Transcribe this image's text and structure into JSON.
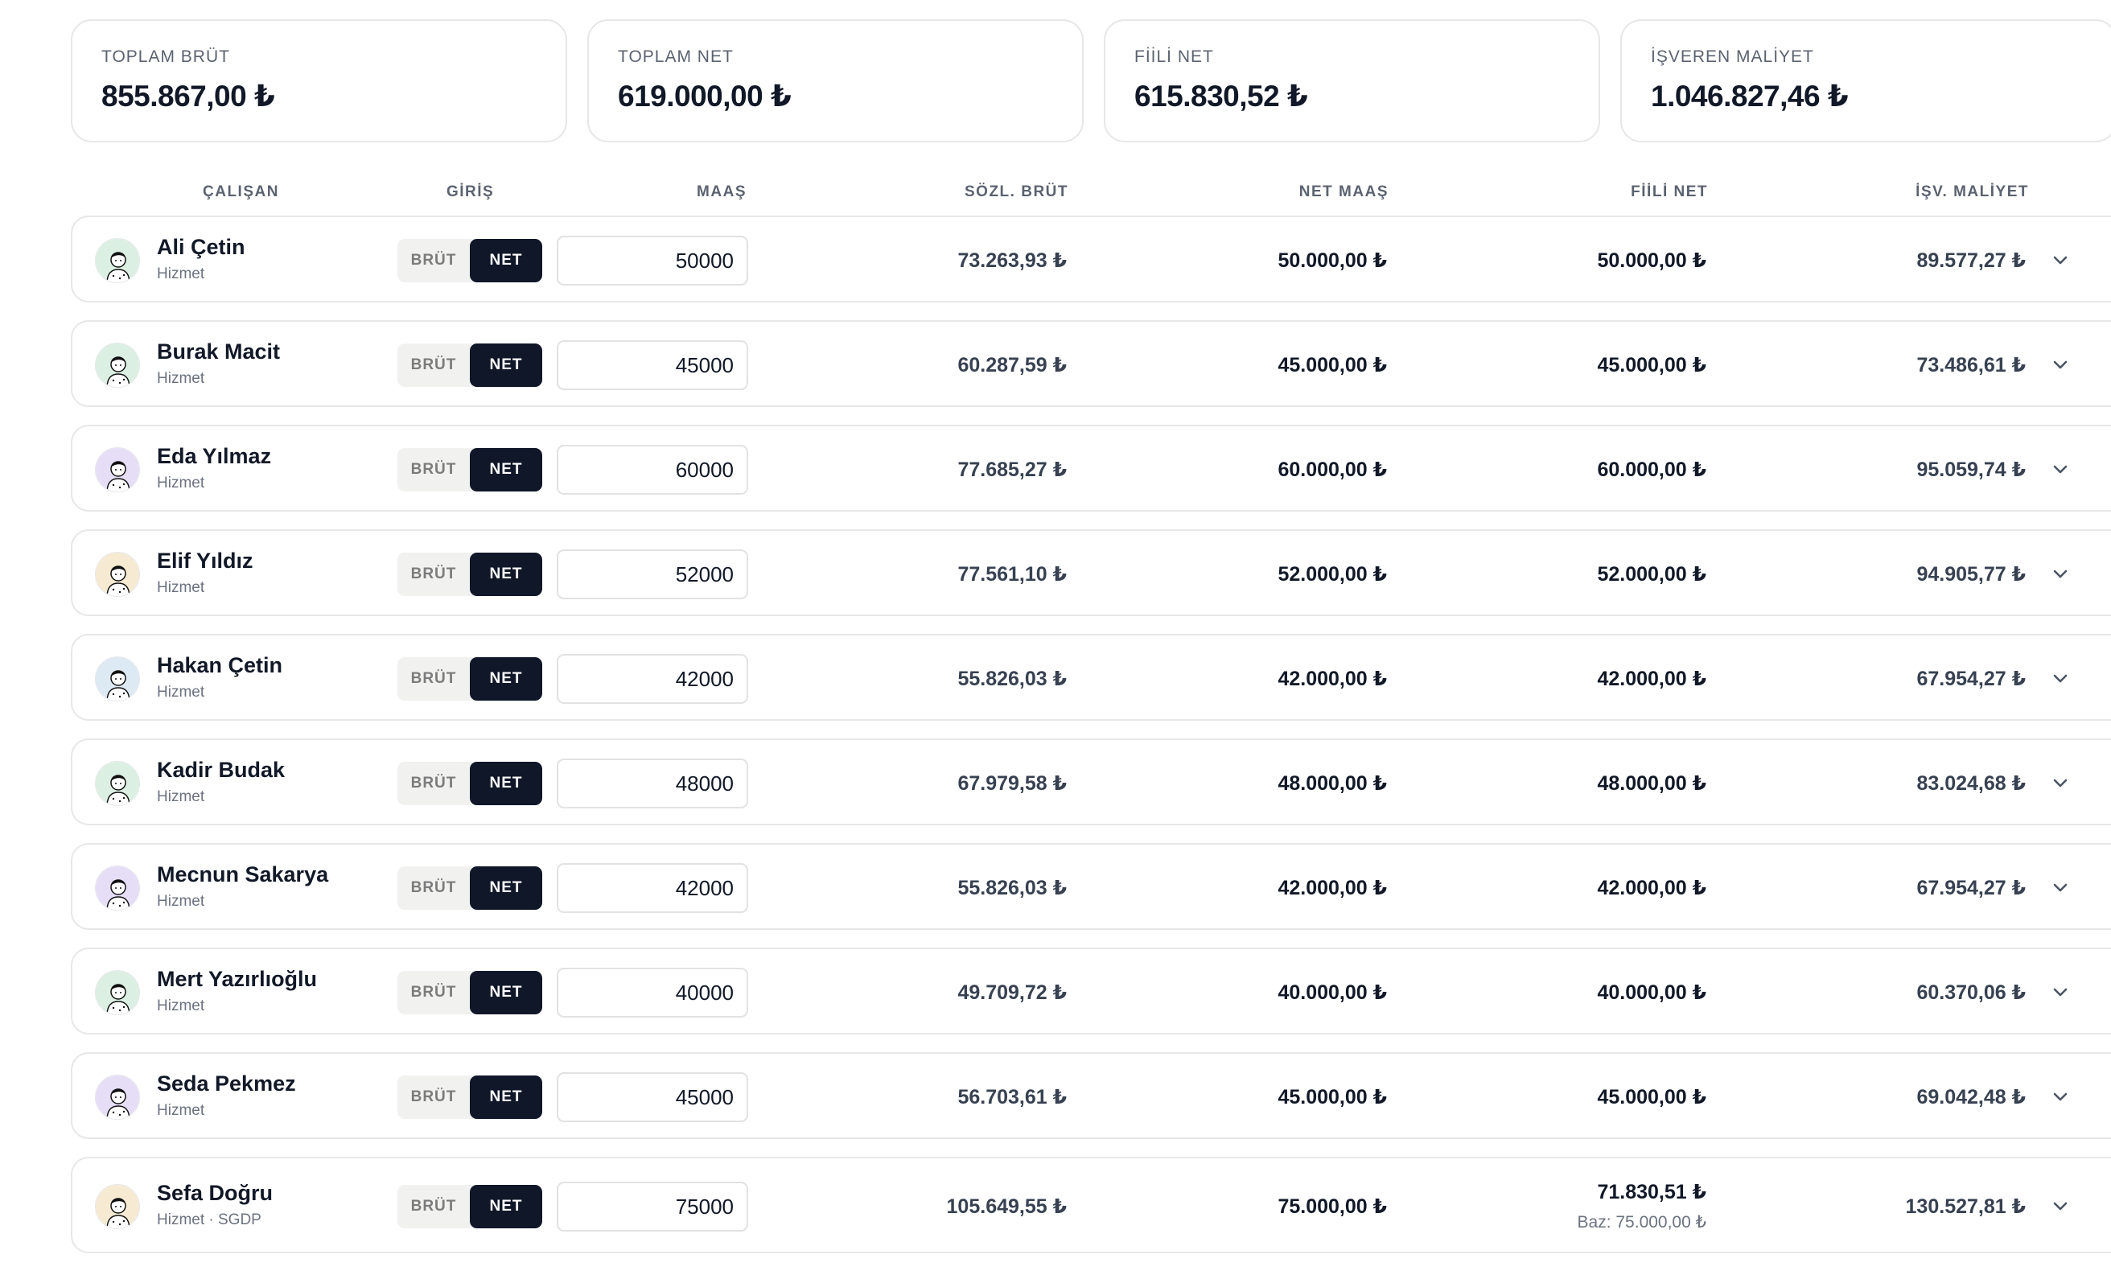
{
  "summary": [
    {
      "label": "TOPLAM BRÜT",
      "value": "855.867,00 ₺"
    },
    {
      "label": "TOPLAM NET",
      "value": "619.000,00 ₺"
    },
    {
      "label": "FİİLİ NET",
      "value": "615.830,52 ₺"
    },
    {
      "label": "İŞVEREN MALİYET",
      "value": "1.046.827,46 ₺"
    }
  ],
  "headers": {
    "employee": "ÇALIŞAN",
    "entry": "GİRİŞ",
    "salary": "MAAŞ",
    "contract_gross": "SÖZL. BRÜT",
    "net_salary": "NET MAAŞ",
    "actual_net": "FİİLİ NET",
    "employer_cost": "İŞV. MALİYET"
  },
  "toggle": {
    "gross_label": "BRÜT",
    "net_label": "NET",
    "selected": "NET"
  },
  "rows": [
    {
      "name": "Ali Çetin",
      "type": "Hizmet",
      "salary": "50000",
      "contract_gross": "73.263,93 ₺",
      "net_salary": "50.000,00 ₺",
      "actual_net": "50.000,00 ₺",
      "employer_cost": "89.577,27 ₺",
      "avatar_bg": "#dcefe3"
    },
    {
      "name": "Burak Macit",
      "type": "Hizmet",
      "salary": "45000",
      "contract_gross": "60.287,59 ₺",
      "net_salary": "45.000,00 ₺",
      "actual_net": "45.000,00 ₺",
      "employer_cost": "73.486,61 ₺",
      "avatar_bg": "#dcefe3"
    },
    {
      "name": "Eda Yılmaz",
      "type": "Hizmet",
      "salary": "60000",
      "contract_gross": "77.685,27 ₺",
      "net_salary": "60.000,00 ₺",
      "actual_net": "60.000,00 ₺",
      "employer_cost": "95.059,74 ₺",
      "avatar_bg": "#e6def7"
    },
    {
      "name": "Elif Yıldız",
      "type": "Hizmet",
      "salary": "52000",
      "contract_gross": "77.561,10 ₺",
      "net_salary": "52.000,00 ₺",
      "actual_net": "52.000,00 ₺",
      "employer_cost": "94.905,77 ₺",
      "avatar_bg": "#f6ead2"
    },
    {
      "name": "Hakan Çetin",
      "type": "Hizmet",
      "salary": "42000",
      "contract_gross": "55.826,03 ₺",
      "net_salary": "42.000,00 ₺",
      "actual_net": "42.000,00 ₺",
      "employer_cost": "67.954,27 ₺",
      "avatar_bg": "#dde9f3"
    },
    {
      "name": "Kadir Budak",
      "type": "Hizmet",
      "salary": "48000",
      "contract_gross": "67.979,58 ₺",
      "net_salary": "48.000,00 ₺",
      "actual_net": "48.000,00 ₺",
      "employer_cost": "83.024,68 ₺",
      "avatar_bg": "#dcefe3"
    },
    {
      "name": "Mecnun Sakarya",
      "type": "Hizmet",
      "salary": "42000",
      "contract_gross": "55.826,03 ₺",
      "net_salary": "42.000,00 ₺",
      "actual_net": "42.000,00 ₺",
      "employer_cost": "67.954,27 ₺",
      "avatar_bg": "#e6def7"
    },
    {
      "name": "Mert Yazırlıoğlu",
      "type": "Hizmet",
      "salary": "40000",
      "contract_gross": "49.709,72 ₺",
      "net_salary": "40.000,00 ₺",
      "actual_net": "40.000,00 ₺",
      "employer_cost": "60.370,06 ₺",
      "avatar_bg": "#dcefe3"
    },
    {
      "name": "Seda Pekmez",
      "type": "Hizmet",
      "salary": "45000",
      "contract_gross": "56.703,61 ₺",
      "net_salary": "45.000,00 ₺",
      "actual_net": "45.000,00 ₺",
      "employer_cost": "69.042,48 ₺",
      "avatar_bg": "#e6def7"
    },
    {
      "name": "Sefa Doğru",
      "type": "Hizmet · SGDP",
      "salary": "75000",
      "contract_gross": "105.649,55 ₺",
      "net_salary": "75.000,00 ₺",
      "actual_net": "71.830,51 ₺",
      "actual_net_base": "Baz: 75.000,00 ₺",
      "employer_cost": "130.527,81 ₺",
      "avatar_bg": "#f6ead2"
    }
  ]
}
